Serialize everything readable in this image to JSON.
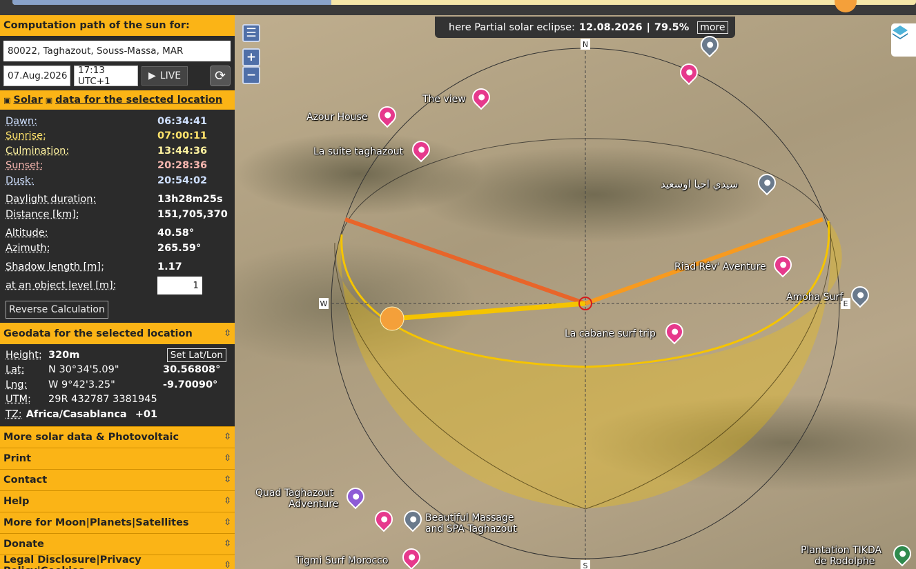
{
  "panel": {
    "computation_header": "Computation path of the sun for:",
    "location_value": "80022, Taghazout, Souss-Massa, MAR",
    "date_value": "07.Aug.2026",
    "time_value": "17:13 UTC+1",
    "live_label": "LIVE",
    "solar_header_word1": "Solar",
    "solar_header_word2": "data for the selected location",
    "solar": {
      "dawn_label": "Dawn:",
      "dawn": "06:34:41",
      "sunrise_label": "Sunrise:",
      "sunrise": "07:00:11",
      "culmination_label": "Culmination:",
      "culmination": "13:44:36",
      "sunset_label": "Sunset:",
      "sunset": "20:28:36",
      "dusk_label": "Dusk:",
      "dusk": "20:54:02",
      "daylight_label": "Daylight duration:",
      "daylight": "13h28m25s",
      "distance_label": "Distance [km]:",
      "distance": "151,705,370",
      "altitude_label": "Altitude:",
      "altitude": "40.58°",
      "azimuth_label": "Azimuth:",
      "azimuth": "265.59°",
      "shadow_label": "Shadow length [m]:",
      "shadow": "1.17",
      "object_level_label": "at an object level [m]:",
      "object_level": "1",
      "reverse_label": "Reverse Calculation"
    },
    "geodata_header": "Geodata for the selected location",
    "geo": {
      "height_label": "Height:",
      "height": "320m",
      "setlatlon_label": "Set Lat/Lon",
      "lat_label": "Lat:",
      "lat_dms": "N 30°34'5.09\"",
      "lat_dec": "30.56808°",
      "lng_label": "Lng:",
      "lng_dms": "W 9°42'3.25\"",
      "lng_dec": "-9.70090°",
      "utm_label": "UTM:",
      "utm": "29R 432787 3381945",
      "tz_label": "TZ:",
      "tz": "Africa/Casablanca",
      "tz_offset": "+01"
    },
    "accordion": [
      "More solar data & Photovoltaic",
      "Print",
      "Contact",
      "Help",
      "More for Moon|Planets|Satellites",
      "Donate",
      "Legal Disclosure|Privacy Policy|Cookies"
    ]
  },
  "map": {
    "eclipse_prefix": "here Partial solar eclipse:",
    "eclipse_date": "12.08.2026",
    "eclipse_sep": "|",
    "eclipse_pct": "79.5%",
    "more_label": "more",
    "compass": {
      "n": "N",
      "s": "S",
      "e": "E",
      "w": "W"
    },
    "pois": {
      "the_view": "The view",
      "azour_house": "Azour House",
      "la_suite": "La suite taghazout",
      "sidi": "سيدي احيا اوسعيد",
      "riad": "Riad Rêv' Aventure",
      "amoha": "Amoha Surf",
      "cabane": "La cabane surf trip",
      "quad_1": "Quad Taghazout",
      "quad_2": "Adventure",
      "massage_1": "Beautiful Massage",
      "massage_2": "and SPA Taghazout",
      "tigmi": "Tigmi Surf Morocco",
      "plantation_1": "Plantation TIKDA",
      "plantation_2": "de Rodolphe"
    },
    "colors": {
      "sun_path": "#f5c400",
      "sunrise_line": "#f79a1f",
      "sunset_line": "#e8652a",
      "sun_disk": "#f4a03a"
    }
  }
}
